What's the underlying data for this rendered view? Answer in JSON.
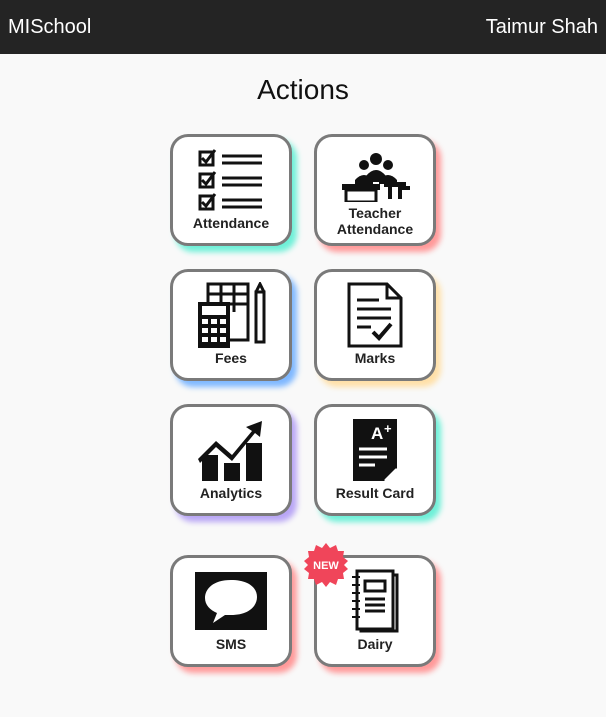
{
  "header": {
    "brand": "MISchool",
    "user": "Taimur Shah"
  },
  "page": {
    "title": "Actions"
  },
  "actions": [
    {
      "label": "Attendance",
      "icon": "checklist-icon",
      "glow": "#6ff0d8"
    },
    {
      "label": "Teacher Attendance",
      "icon": "classroom-icon",
      "glow": "#ff9a9a"
    },
    {
      "label": "Fees",
      "icon": "calculator-icon",
      "glow": "#7fb8ff"
    },
    {
      "label": "Marks",
      "icon": "document-check-icon",
      "glow": "#ffe0a8"
    },
    {
      "label": "Analytics",
      "icon": "chart-growth-icon",
      "glow": "#b9a6f5"
    },
    {
      "label": "Result Card",
      "icon": "result-card-icon",
      "glow": "#6ff0d8"
    },
    {
      "label": "SMS",
      "icon": "chat-bubble-icon",
      "glow": "#ff9a9a"
    },
    {
      "label": "Dairy",
      "icon": "notebook-icon",
      "glow": "#ff9a9a",
      "badge": "NEW"
    }
  ],
  "colors": {
    "header_bg": "#242424",
    "badge": "#f0455a"
  }
}
